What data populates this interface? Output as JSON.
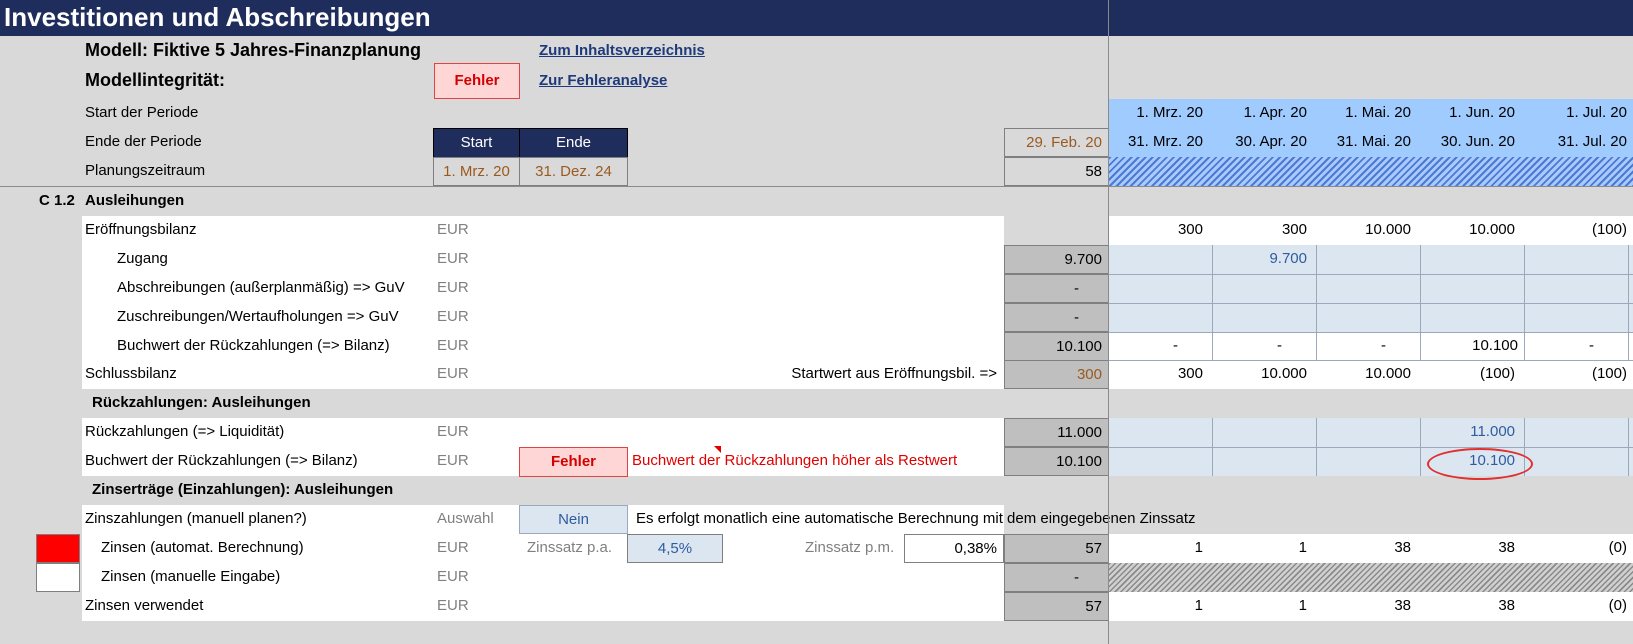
{
  "title": "Investitionen und Abschreibungen",
  "model": {
    "name": "Modell: Fiktive 5 Jahres-Finanzplanung",
    "integrity_label": "Modellintegrität:",
    "integrity_status": "Fehler",
    "link_toc": "Zum Inhaltsverzeichnis",
    "link_errors": "Zur Fehleranalyse"
  },
  "period": {
    "start_label": "Start der Periode",
    "end_label": "Ende der Periode",
    "plan_label": "Planungszeitraum",
    "start_header": "Start",
    "end_header": "Ende",
    "start_date": "1. Mrz. 20",
    "end_date": "31. Dez. 24",
    "prior_end": "29. Feb. 20",
    "duration": "58",
    "starts": [
      "1. Mrz. 20",
      "1. Apr. 20",
      "1. Mai. 20",
      "1. Jun. 20",
      "1. Jul. 20"
    ],
    "ends": [
      "31. Mrz. 20",
      "30. Apr. 20",
      "31. Mai. 20",
      "30. Jun. 20",
      "31. Jul. 20"
    ]
  },
  "section": {
    "number": "C 1.2",
    "title": "Ausleihungen"
  },
  "unit": "EUR",
  "rows": {
    "opening": {
      "label": "Eröffnungsbilanz",
      "values": [
        "300",
        "300",
        "10.000",
        "10.000",
        "(100)"
      ]
    },
    "additions": {
      "label": "Zugang",
      "total": "9.700",
      "values": [
        "",
        "9.700",
        "",
        "",
        ""
      ]
    },
    "depreciation": {
      "label": "Abschreibungen (außerplanmäßig) => GuV",
      "total": "-"
    },
    "appreciation": {
      "label": "Zuschreibungen/Wertaufholungen => GuV",
      "total": "-"
    },
    "bookvalue_repay": {
      "label": "Buchwert der Rückzahlungen (=> Bilanz)",
      "total": "10.100",
      "values": [
        "-",
        "-",
        "-",
        "10.100",
        "-"
      ]
    },
    "closing": {
      "label": "Schlussbilanz",
      "note": "Startwert aus Eröffnungsbil. =>",
      "total": "300",
      "values": [
        "300",
        "10.000",
        "10.000",
        "(100)",
        "(100)"
      ]
    }
  },
  "repayments": {
    "title": "Rückzahlungen: Ausleihungen",
    "liquidity": {
      "label": "Rückzahlungen (=> Liquidität)",
      "total": "11.000",
      "values": [
        "",
        "",
        "",
        "11.000",
        ""
      ]
    },
    "bookvalue": {
      "label": "Buchwert der Rückzahlungen (=> Bilanz)",
      "status": "Fehler",
      "message": "Buchwert der Rückzahlungen höher als Restwert",
      "total": "10.100",
      "values": [
        "",
        "",
        "",
        "10.100",
        ""
      ]
    }
  },
  "interest": {
    "title": "Zinserträge (Einzahlungen): Ausleihungen",
    "manual": {
      "label": "Zinszahlungen (manuell planen?)",
      "unit": "Auswahl",
      "choice": "Nein",
      "note": "Es erfolgt monatlich eine automatische Berechnung mit dem eingegebenen Zinssatz"
    },
    "auto": {
      "label": "Zinsen (automat. Berechnung)",
      "rate_pa_label": "Zinssatz p.a.",
      "rate_pa": "4,5%",
      "rate_pm_label": "Zinssatz p.m.",
      "rate_pm": "0,38%",
      "total": "57",
      "values": [
        "1",
        "1",
        "38",
        "38",
        "(0)"
      ]
    },
    "manual_input": {
      "label": "Zinsen (manuelle Eingabe)",
      "total": "-"
    },
    "used": {
      "label": "Zinsen verwendet",
      "total": "57",
      "values": [
        "1",
        "1",
        "38",
        "38",
        "(0)"
      ]
    }
  },
  "colors": {
    "header": "#1f2d5c",
    "input": "#dce6f1",
    "error": "#e00000",
    "timeline": "#9fcbff"
  }
}
